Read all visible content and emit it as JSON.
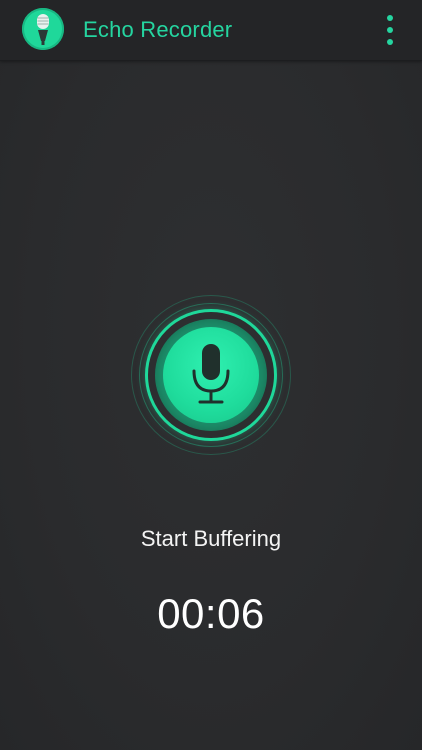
{
  "header": {
    "title": "Echo Recorder",
    "logo_icon": "microphone-icon",
    "menu_icon": "more-vertical-icon"
  },
  "recorder": {
    "button_icon": "microphone-icon",
    "status": "Start Buffering",
    "elapsed": "00:06"
  },
  "colors": {
    "accent": "#1fd89a",
    "title": "#25d5a0",
    "background": "#2b2c2e",
    "topbar": "#242527",
    "text": "#ffffff"
  }
}
